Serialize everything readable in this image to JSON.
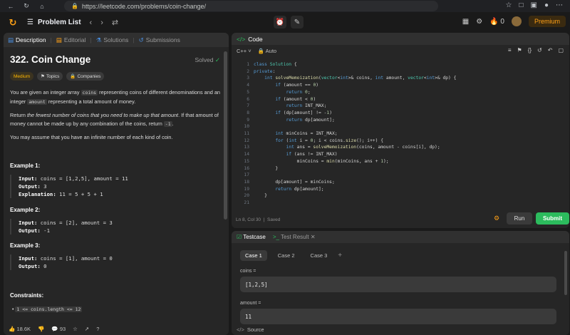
{
  "browser": {
    "url": "https://leetcode.com/problems/coin-change/"
  },
  "appbar": {
    "problem_list": "Problem List",
    "streak": "0",
    "premium": "Premium"
  },
  "left": {
    "tabs": [
      "Description",
      "Editorial",
      "Solutions",
      "Submissions"
    ],
    "title": "322. Coin Change",
    "solved": "Solved",
    "chips": [
      "Medium",
      "Topics",
      "Companies"
    ],
    "desc1_a": "You are given an integer array ",
    "desc1_code1": "coins",
    "desc1_b": " representing coins of different denominations and an integer ",
    "desc1_code2": "amount",
    "desc1_c": " representing a total amount of money.",
    "desc2_a": "Return ",
    "desc2_em": "the fewest number of coins that you need to make up that amount",
    "desc2_b": ". If that amount of money cannot be made up by any combination of the coins, return ",
    "desc2_code": "-1",
    "desc2_c": ".",
    "desc3": "You may assume that you have an infinite number of each kind of coin.",
    "ex1_h": "Example 1:",
    "ex1_in": "coins = [1,2,5], amount = 11",
    "ex1_out": "3",
    "ex1_exp": "11 = 5 + 5 + 1",
    "ex2_h": "Example 2:",
    "ex2_in": "coins = [2], amount = 3",
    "ex2_out": "-1",
    "ex3_h": "Example 3:",
    "ex3_in": "coins = [1], amount = 0",
    "ex3_out": "0",
    "input_label": "Input:",
    "output_label": "Output:",
    "exp_label": "Explanation:",
    "constraints_h": "Constraints:",
    "constraint1": "1 <= coins.length <= 12",
    "likes": "18.6K",
    "comments": "93"
  },
  "code": {
    "title": "Code",
    "lang": "C++",
    "mode": "Auto",
    "status": "Ln 8, Col 30",
    "saved": "Saved",
    "run": "Run",
    "submit": "Submit"
  },
  "testcase": {
    "tab1": "Testcase",
    "tab2": "Test Result",
    "cases": [
      "Case 1",
      "Case 2",
      "Case 3"
    ],
    "label1": "coins =",
    "value1": "[1,2,5]",
    "label2": "amount =",
    "value2": "11",
    "source": "Source"
  }
}
